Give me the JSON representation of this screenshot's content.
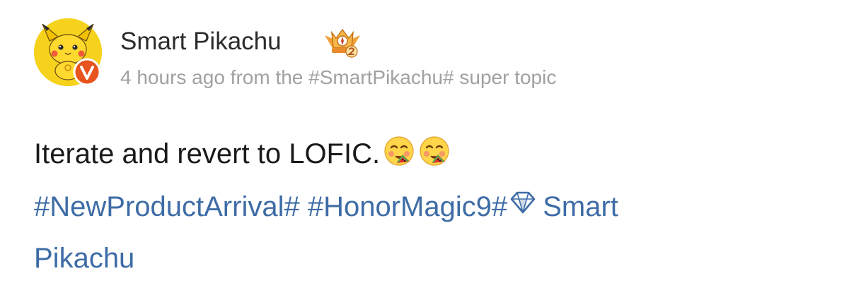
{
  "user": {
    "name": "Smart Pikachu"
  },
  "meta": {
    "prefix": "4 hours ago from the ",
    "topic": "#SmartPikachu#",
    "suffix": " super topic"
  },
  "post": {
    "text": "Iterate and revert to LOFIC.",
    "hashtags": [
      "#NewProductArrival#",
      "#HonorMagic9#"
    ],
    "mention_part1": "Smart",
    "mention_part2": "Pikachu"
  },
  "colors": {
    "link": "#3e6ca6",
    "meta": "#a1a1a1",
    "verified": "#e8541e",
    "avatar_bg": "#f6d21d"
  },
  "icons": {
    "avatar": "pikachu-avatar",
    "verified": "verified-v-badge-icon",
    "rank": "crown-rank-badge-icon",
    "emoji": "savoring-food-emoji",
    "super_topic": "diamond-icon"
  }
}
